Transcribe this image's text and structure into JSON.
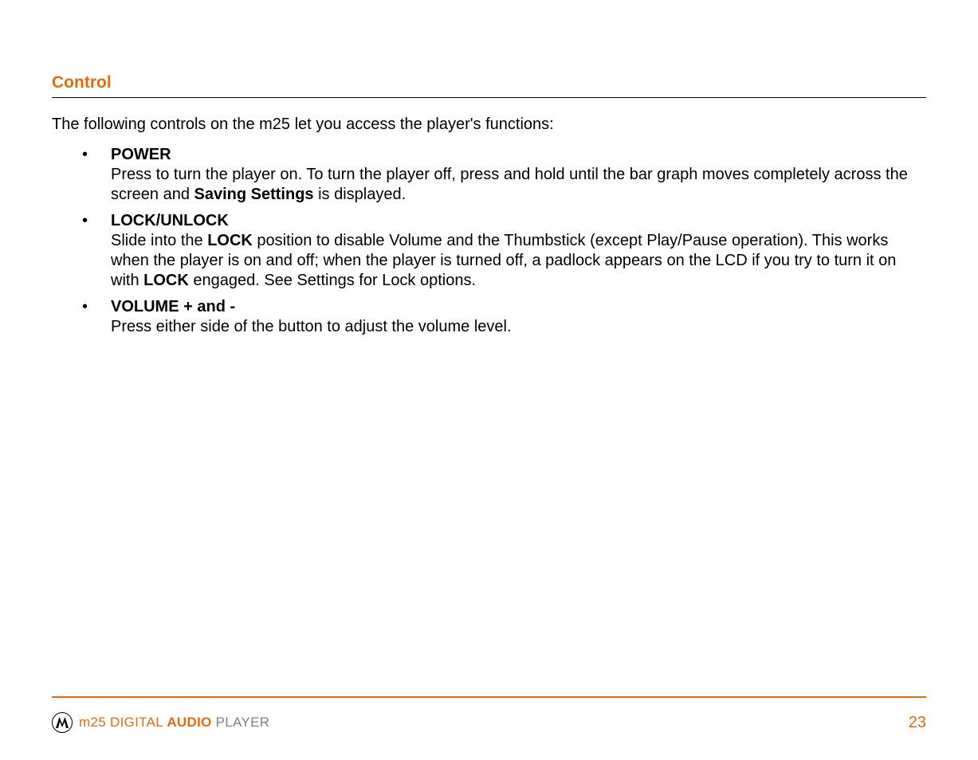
{
  "section": {
    "title": "Control",
    "intro": "The following controls on the m25 let you access the player's functions:"
  },
  "items": [
    {
      "title": "POWER",
      "body_pre": "Press to turn the player on. To turn the player off, press and hold until the bar graph moves completely across the screen and ",
      "bold1": "Saving Settings",
      "body_post": " is displayed."
    },
    {
      "title": "LOCK/UNLOCK",
      "body_pre": "Slide into the ",
      "bold1": "LOCK",
      "body_mid": " position to disable Volume and the Thumbstick (except Play/Pause operation). This works when the player is on and off; when the player is turned off, a padlock appears on the LCD if you try to turn it on with ",
      "bold2": "LOCK",
      "body_post": " engaged. See Settings for Lock options."
    },
    {
      "title": "VOLUME + and -",
      "body_pre": "Press either side of the button to adjust the volume level.",
      "bold1": "",
      "body_post": ""
    }
  ],
  "footer": {
    "prefix": "m25 DIGITAL ",
    "audio": "AUDIO",
    "player": " PLAYER",
    "page": "23"
  }
}
